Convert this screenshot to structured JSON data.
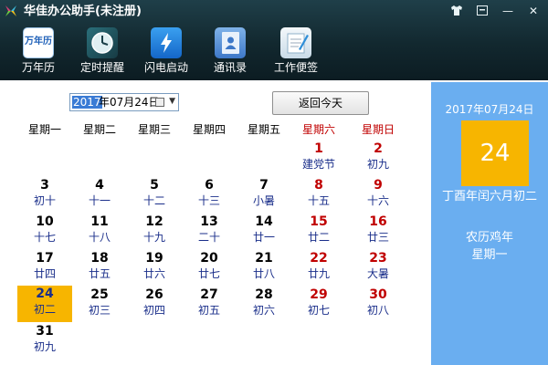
{
  "app": {
    "title": "华佳办公助手(未注册)"
  },
  "window_controls": [
    {
      "name": "skin-icon",
      "glyph": ""
    },
    {
      "name": "minimize-to-tray-icon",
      "glyph": ""
    },
    {
      "name": "minimize-icon",
      "glyph": "—"
    },
    {
      "name": "close-icon",
      "glyph": "✕"
    }
  ],
  "toolbar": {
    "items": [
      {
        "label": "万年历",
        "icon": "calendar-icon",
        "icon_text": "万年历"
      },
      {
        "label": "定时提醒",
        "icon": "clock-icon"
      },
      {
        "label": "闪电启动",
        "icon": "lightning-icon"
      },
      {
        "label": "通讯录",
        "icon": "address-book-icon"
      },
      {
        "label": "工作便签",
        "icon": "notepad-icon"
      }
    ]
  },
  "date_picker": {
    "selected": "2017",
    "rest": "年07月24日"
  },
  "today_button": {
    "label": "返回今天"
  },
  "weekdays": [
    "星期一",
    "星期二",
    "星期三",
    "星期四",
    "星期五",
    "星期六",
    "星期日"
  ],
  "calendar": {
    "days": [
      {
        "n": "1",
        "l": "建党节",
        "red": true
      },
      {
        "n": "2",
        "l": "初九",
        "red": true
      },
      {
        "n": "3",
        "l": "初十"
      },
      {
        "n": "4",
        "l": "十一"
      },
      {
        "n": "5",
        "l": "十二"
      },
      {
        "n": "6",
        "l": "十三"
      },
      {
        "n": "7",
        "l": "小暑"
      },
      {
        "n": "8",
        "l": "十五",
        "red": true
      },
      {
        "n": "9",
        "l": "十六",
        "red": true
      },
      {
        "n": "10",
        "l": "十七"
      },
      {
        "n": "11",
        "l": "十八"
      },
      {
        "n": "12",
        "l": "十九"
      },
      {
        "n": "13",
        "l": "二十"
      },
      {
        "n": "14",
        "l": "廿一"
      },
      {
        "n": "15",
        "l": "廿二",
        "red": true
      },
      {
        "n": "16",
        "l": "廿三",
        "red": true
      },
      {
        "n": "17",
        "l": "廿四"
      },
      {
        "n": "18",
        "l": "廿五"
      },
      {
        "n": "19",
        "l": "廿六"
      },
      {
        "n": "20",
        "l": "廿七"
      },
      {
        "n": "21",
        "l": "廿八"
      },
      {
        "n": "22",
        "l": "廿九",
        "red": true
      },
      {
        "n": "23",
        "l": "大暑",
        "red": true
      },
      {
        "n": "24",
        "l": "初二",
        "today": true
      },
      {
        "n": "25",
        "l": "初三"
      },
      {
        "n": "26",
        "l": "初四"
      },
      {
        "n": "27",
        "l": "初五"
      },
      {
        "n": "28",
        "l": "初六"
      },
      {
        "n": "29",
        "l": "初七",
        "red": true
      },
      {
        "n": "30",
        "l": "初八",
        "red": true
      },
      {
        "n": "31",
        "l": "初九"
      }
    ]
  },
  "panel": {
    "date": "2017年07月24日",
    "day": "24",
    "lunar": "丁酉年闰六月初二",
    "zodiac_year": "农历鸡年",
    "weekday": "星期一"
  },
  "colors": {
    "header": "#12282f",
    "today_highlight": "#f7b500",
    "panel_bg": "#6aaef0",
    "weekend_red": "#c00000",
    "lunar_blue": "#1a2e8a"
  }
}
